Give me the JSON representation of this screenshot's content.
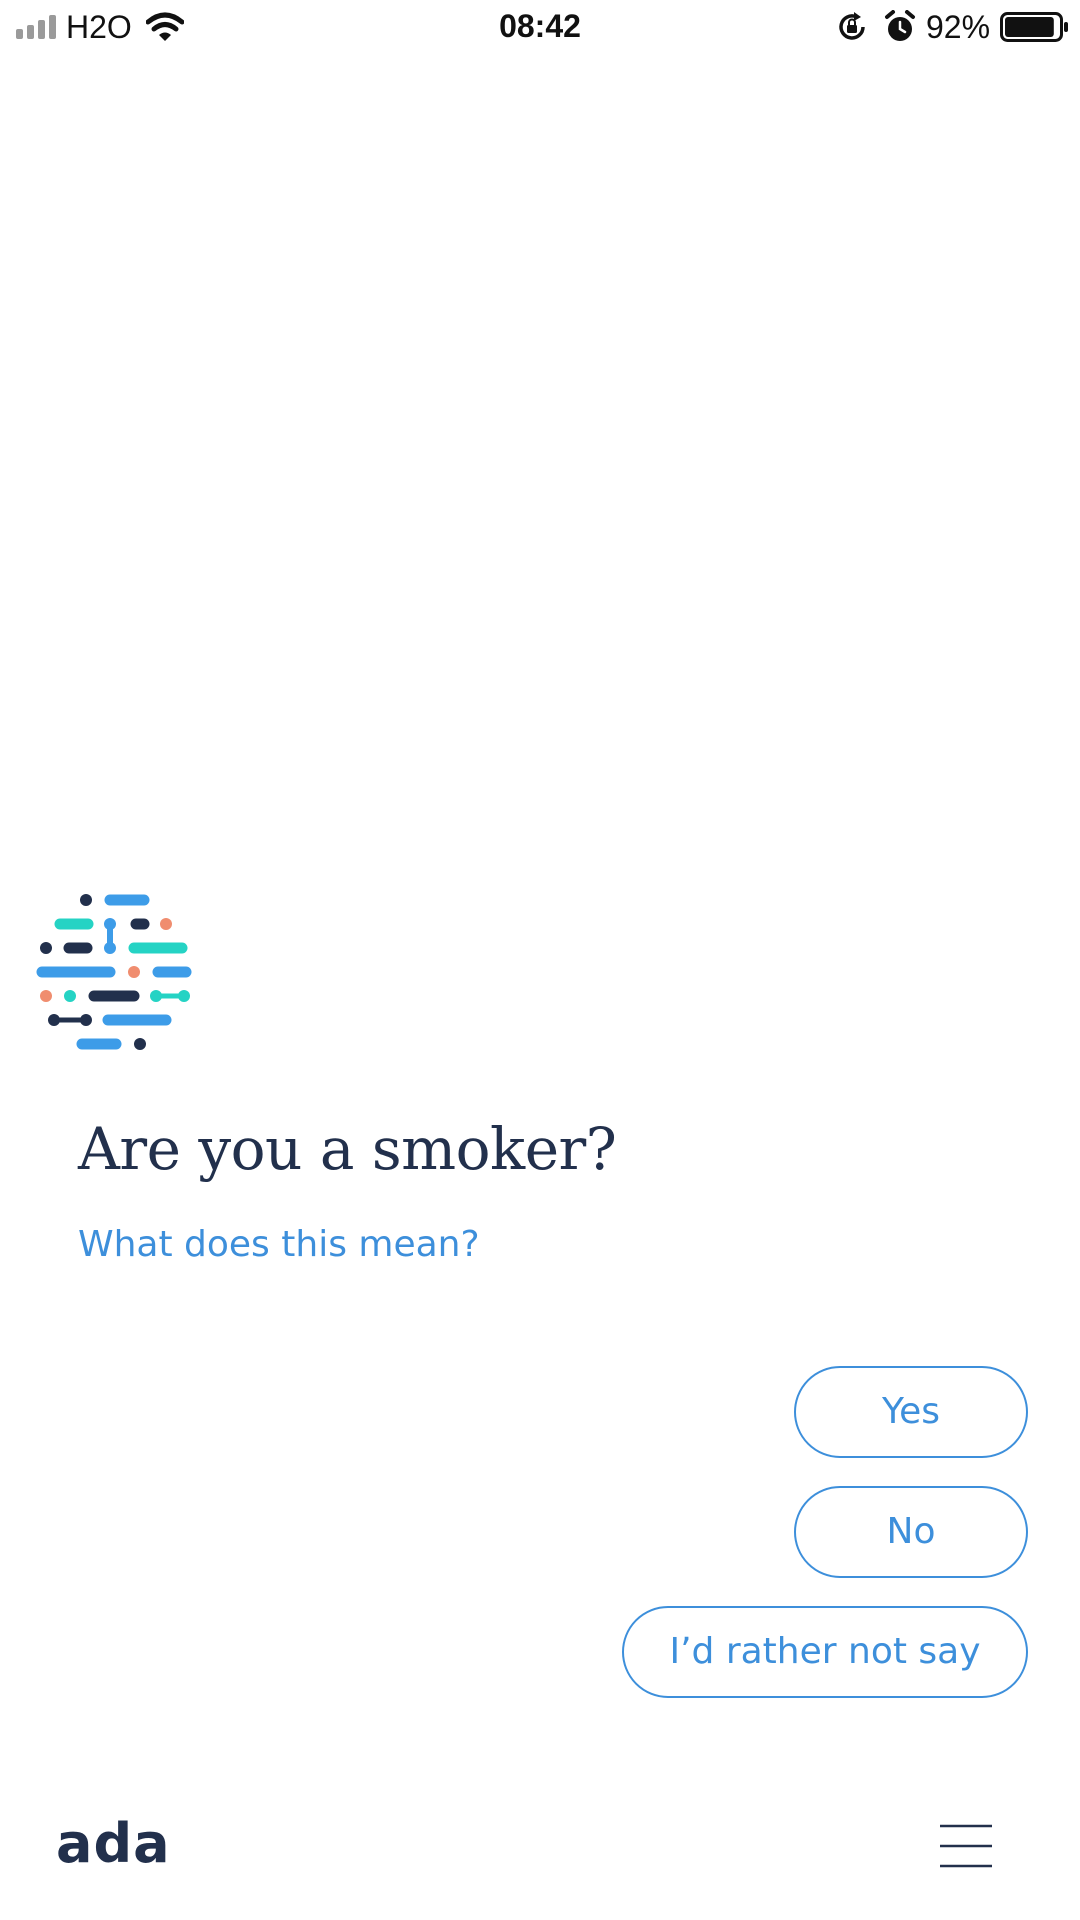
{
  "status_bar": {
    "carrier": "H2O",
    "time": "08:42",
    "battery_percent": "92%",
    "battery_level": 0.92,
    "icons": [
      "signal-icon",
      "wifi-icon",
      "rotation-lock-icon",
      "alarm-icon",
      "battery-icon"
    ]
  },
  "chat": {
    "avatar_icon": "ada-avatar-icon",
    "question": "Are you a smoker?",
    "help_link": "What does this mean?"
  },
  "answers": {
    "yes": "Yes",
    "no": "No",
    "rather_not": "I’d rather not say"
  },
  "footer": {
    "brand": "ada",
    "menu_icon": "hamburger-menu-icon"
  },
  "colors": {
    "primary_blue": "#3d8fdb",
    "navy": "#22304c",
    "teal": "#25d3c4",
    "coral": "#f08d6f",
    "light_blue": "#3d9ce8",
    "background": "#ffffff"
  }
}
